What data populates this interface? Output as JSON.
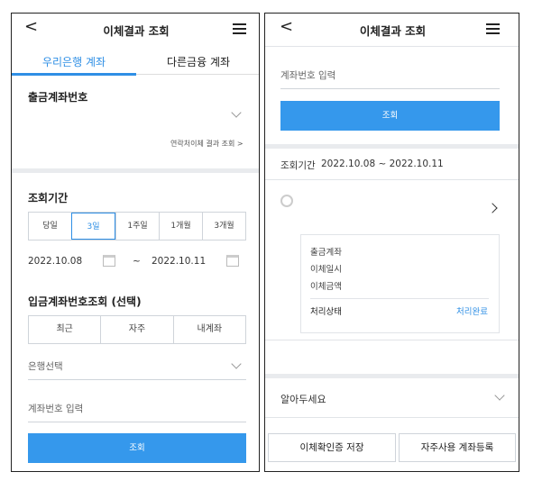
{
  "left": {
    "header": {
      "title": "이체결과 조회",
      "back": "<"
    },
    "tabs": {
      "ours": "우리은행 계좌",
      "other": "다른금융 계좌"
    },
    "withdraw": {
      "label": "출금계좌번호",
      "contact_link": "연락처이체 결과 조회 >"
    },
    "period": {
      "label": "조회기간",
      "options": [
        "당일",
        "3일",
        "1주일",
        "1개월",
        "3개월"
      ],
      "selected": "3일",
      "from": "2022.10.08",
      "sep": "~",
      "to": "2022.10.11"
    },
    "deposit": {
      "label": "입금계좌번호조회 (선택)",
      "options": [
        "최근",
        "자주",
        "내계좌"
      ],
      "bank_select": "은행선택",
      "account_placeholder": "계좌번호 입력"
    },
    "query_button": "조회"
  },
  "right": {
    "header": {
      "title": "이체결과 조회",
      "back": "<"
    },
    "account_placeholder": "계좌번호 입력",
    "query_button": "조회",
    "period_label": "조회기간",
    "period_value": "2022.10.08 ~ 2022.10.11",
    "details": {
      "account": "출금계좌",
      "datetime": "이체일시",
      "amount": "이체금액",
      "status_label": "처리상태",
      "status_value": "처리완료"
    },
    "notice": "알아두세요",
    "buttons": {
      "save_cert": "이체확인증 저장",
      "register_frequent": "자주사용 계좌등록"
    }
  },
  "colors": {
    "accent": "#2f8fe5",
    "button": "#3598ec",
    "divider": "#e9ebee"
  }
}
